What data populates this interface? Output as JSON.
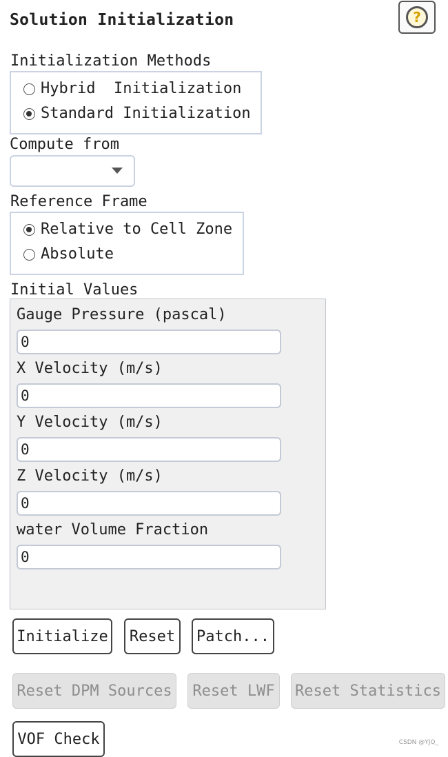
{
  "panel": {
    "title": "Solution Initialization",
    "help_icon": "question-icon",
    "help_glyph": "?"
  },
  "init_methods": {
    "label": "Initialization Methods",
    "options": [
      {
        "label": "Hybrid  Initialization",
        "checked": false
      },
      {
        "label": "Standard Initialization",
        "checked": true
      }
    ]
  },
  "compute_from": {
    "label": "Compute from",
    "selected": ""
  },
  "reference_frame": {
    "label": "Reference Frame",
    "options": [
      {
        "label": "Relative to Cell Zone",
        "checked": true
      },
      {
        "label": "Absolute",
        "checked": false
      }
    ]
  },
  "initial_values": {
    "label": "Initial Values",
    "fields": [
      {
        "label": "Gauge Pressure (pascal)",
        "value": "0"
      },
      {
        "label": "X Velocity (m/s)",
        "value": "0"
      },
      {
        "label": "Y Velocity (m/s)",
        "value": "0"
      },
      {
        "label": "Z Velocity (m/s)",
        "value": "0"
      },
      {
        "label": "water Volume Fraction",
        "value": "0"
      }
    ]
  },
  "buttons": {
    "initialize": "Initialize",
    "reset": "Reset",
    "patch": "Patch...",
    "reset_dpm": "Reset DPM Sources",
    "reset_lwf": "Reset LWF",
    "reset_statistics": "Reset Statistics",
    "vof_check": "VOF Check"
  },
  "watermark": "CSDN @YJQ_",
  "colors": {
    "help_icon": "#d4a000",
    "group_border": "#c9d3e3",
    "panel_bg": "#f0f0f0",
    "disabled_bg": "#e3e3e3",
    "disabled_text": "#8e8e8e"
  }
}
